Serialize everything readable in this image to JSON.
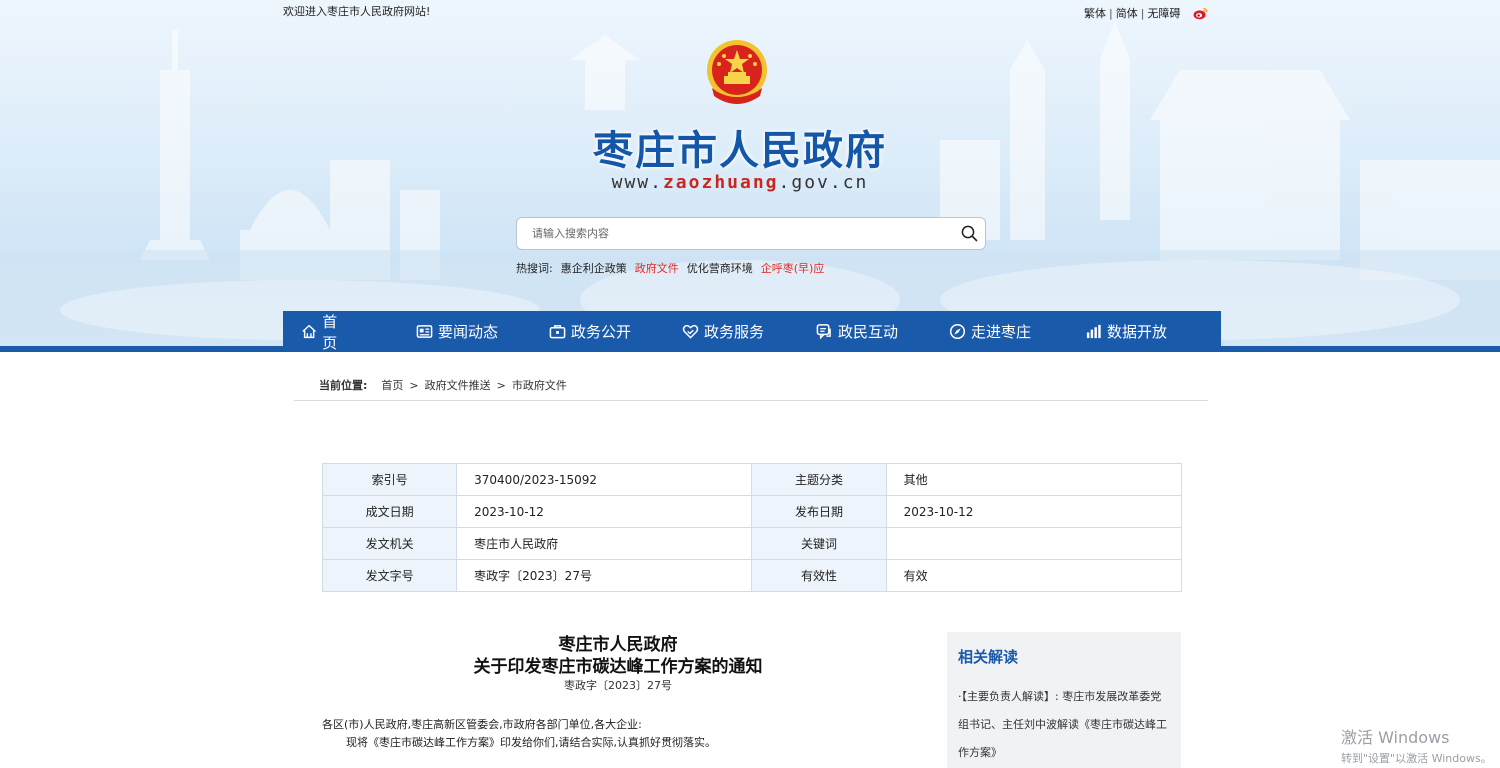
{
  "topbar": {
    "welcome": "欢迎进入枣庄市人民政府网站!",
    "traditional": "繁体",
    "simplified": "简体",
    "accessibility": "无障碍",
    "sep": "|"
  },
  "site": {
    "title": "枣庄市人民政府",
    "url_prefix": "www.",
    "url_domain": "zaozhuang",
    "url_suffix": ".gov.cn"
  },
  "search": {
    "placeholder": "请输入搜索内容",
    "hot_label": "热搜词:",
    "hot_words": [
      {
        "text": "惠企利企政策",
        "color": "#222222"
      },
      {
        "text": "政府文件",
        "color": "#e32b24"
      },
      {
        "text": "优化营商环境",
        "color": "#222222"
      },
      {
        "text": "企呼枣(早)应",
        "color": "#e32b24"
      }
    ]
  },
  "nav": {
    "home": "首 页",
    "items": [
      "要闻动态",
      "政务公开",
      "政务服务",
      "政民互动",
      "走进枣庄",
      "数据开放"
    ]
  },
  "breadcrumb": {
    "label": "当前位置:",
    "items": [
      "首页",
      "政府文件推送",
      "市政府文件"
    ],
    "sep": ">"
  },
  "meta": {
    "rows": [
      {
        "k1": "索引号",
        "v1": "370400/2023-15092",
        "k2": "主题分类",
        "v2": "其他"
      },
      {
        "k1": "成文日期",
        "v1": "2023-10-12",
        "k2": "发布日期",
        "v2": "2023-10-12"
      },
      {
        "k1": "发文机关",
        "v1": "枣庄市人民政府",
        "k2": "关键词",
        "v2": ""
      },
      {
        "k1": "发文字号",
        "v1": "枣政字〔2023〕27号",
        "k2": "有效性",
        "v2": "有效"
      }
    ]
  },
  "article": {
    "title_line1": "枣庄市人民政府",
    "title_line2": "关于印发枣庄市碳达峰工作方案的通知",
    "doc_no": "枣政字〔2023〕27号",
    "salutation": "各区(市)人民政府,枣庄高新区管委会,市政府各部门单位,各大企业:",
    "body": "现将《枣庄市碳达峰工作方案》印发给你们,请结合实际,认真抓好贯彻落实。"
  },
  "related": {
    "title": "相关解读",
    "items": [
      "·【主要负责人解读】: 枣庄市发展改革委党组书记、主任刘中波解读《枣庄市碳达峰工作方案》"
    ]
  },
  "watermark": {
    "line1": "激活 Windows",
    "line2": "转到\"设置\"以激活 Windows。"
  },
  "colors": {
    "brand_blue": "#1a5aab",
    "accent_red": "#e32b24"
  }
}
